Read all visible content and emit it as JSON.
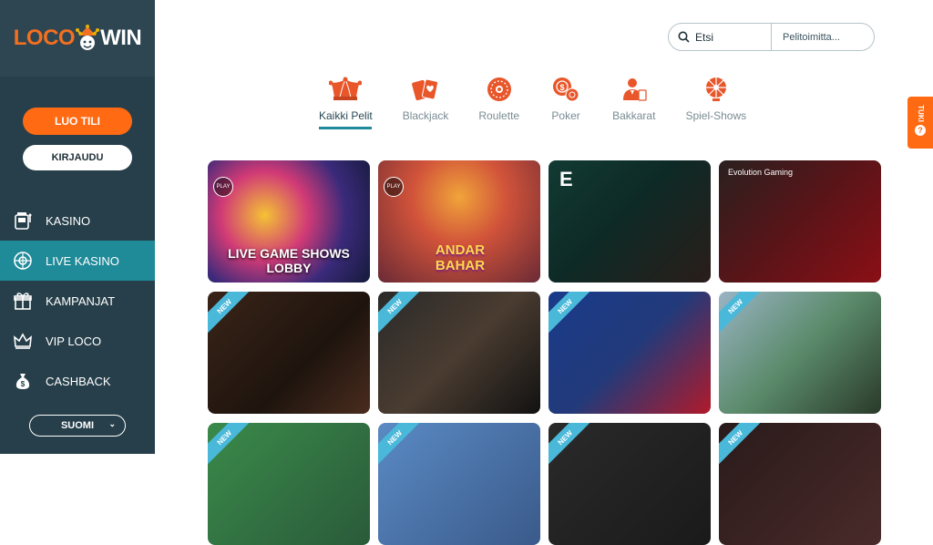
{
  "brand": {
    "part1": "LOCO",
    "part2": "WIN",
    "accent": "#ff6a13",
    "sidebar_bg": "#263f4a"
  },
  "sidebar": {
    "register_label": "LUO TILI",
    "login_label": "KIRJAUDU",
    "items": [
      {
        "label": "KASINO",
        "icon": "slot-machine-icon"
      },
      {
        "label": "LIVE KASINO",
        "icon": "live-roulette-icon",
        "active": true
      },
      {
        "label": "KAMPANJAT",
        "icon": "gift-icon"
      },
      {
        "label": "VIP LOCO",
        "icon": "crown-icon"
      },
      {
        "label": "CASHBACK",
        "icon": "money-bag-icon"
      }
    ],
    "language": "SUOMI"
  },
  "search": {
    "value": "Etsi",
    "provider_label": "Pelitoimitta..."
  },
  "categories": [
    {
      "label": "Kaikki Pelit",
      "icon": "jester-hat-icon",
      "active": true
    },
    {
      "label": "Blackjack",
      "icon": "cards-icon"
    },
    {
      "label": "Roulette",
      "icon": "roulette-icon"
    },
    {
      "label": "Poker",
      "icon": "poker-chips-icon"
    },
    {
      "label": "Bakkarat",
      "icon": "dealer-icon"
    },
    {
      "label": "Spiel-Shows",
      "icon": "wheel-icon"
    }
  ],
  "support": {
    "label": "TUKI",
    "icon": "question-icon"
  },
  "games_row1": [
    {
      "title": "LIVE GAME SHOWS LOBBY",
      "badge": "PLAY"
    },
    {
      "title": "ANDAR BAHAR",
      "badge": "PLAY"
    },
    {
      "title": "",
      "tag": "E"
    },
    {
      "title": "",
      "tag": "Evolution Gaming"
    }
  ],
  "new_badge": "NEW"
}
